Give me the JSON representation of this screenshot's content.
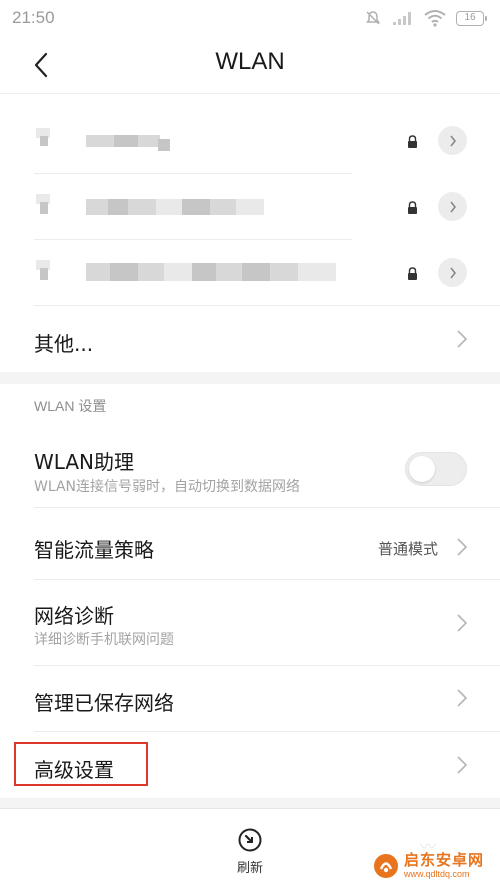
{
  "status_bar": {
    "time": "21:50",
    "battery": "16",
    "icons": [
      "mute-icon",
      "signal-icon",
      "wifi-icon",
      "battery-icon"
    ]
  },
  "header": {
    "title": "WLAN",
    "back_icon": "chevron-left-icon"
  },
  "saved_networks": [
    {
      "name_obscured": true,
      "secured": true
    },
    {
      "name_obscured": true,
      "secured": true
    },
    {
      "name_obscured": true,
      "secured": true
    }
  ],
  "other_row": {
    "label": "其他..."
  },
  "settings": {
    "section_title": "WLAN 设置",
    "wlan_assistant": {
      "label": "WLAN助理",
      "description": "WLAN连接信号弱时，自动切换到数据网络",
      "enabled": false
    },
    "smart_traffic": {
      "label": "智能流量策略",
      "value": "普通模式"
    },
    "diagnostics": {
      "label": "网络诊断",
      "description": "详细诊断手机联网问题"
    },
    "manage_saved": {
      "label": "管理已保存网络"
    },
    "advanced": {
      "label": "高级设置",
      "highlighted": true
    }
  },
  "bottom_bar": {
    "refresh_label": "刷新"
  },
  "watermark": {
    "name": "启东安卓网",
    "url": "www.qdltdq.com"
  },
  "colors": {
    "highlight": "#e0362c",
    "watermark": "#e8741d",
    "section_background": "#f4f4f4"
  }
}
